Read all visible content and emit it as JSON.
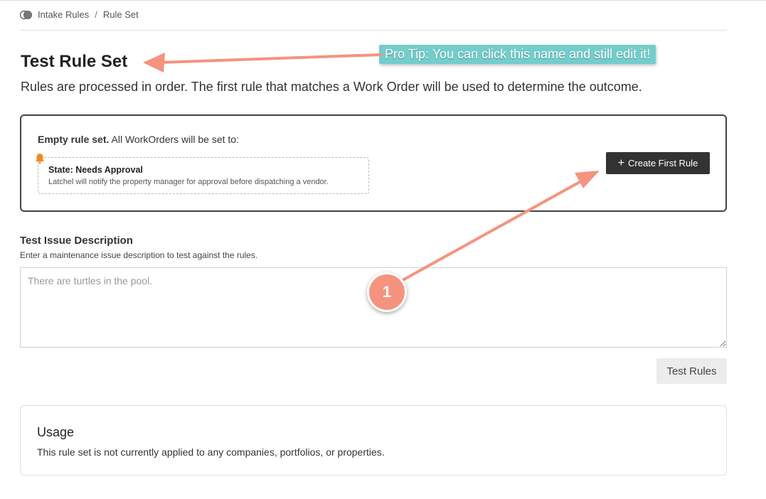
{
  "breadcrumb": {
    "icon": "toggle-circles-icon",
    "items": [
      "Intake Rules",
      "Rule Set"
    ],
    "separator": "/"
  },
  "page": {
    "title": "Test Rule Set",
    "subtitle": "Rules are processed in order. The first rule that matches a Work Order will be used to determine the outcome."
  },
  "annotation": {
    "pro_tip": "Pro Tip: You can click this name and still edit it!",
    "step_number": "1",
    "color": "#f5937f",
    "tip_color": "#72cdcb"
  },
  "rule_set": {
    "empty_bold": "Empty rule set.",
    "empty_rest": " All WorkOrders will be set to:",
    "state_icon": "bell-icon",
    "state_title": "State: Needs Approval",
    "state_description": "Latchel will notify the property manager for approval before dispatching a vendor.",
    "create_button": "Create First Rule",
    "create_icon": "plus-icon"
  },
  "test_issue": {
    "label": "Test Issue Description",
    "help": "Enter a maintenance issue description to test against the rules.",
    "placeholder": "There are turtles in the pool.",
    "value": "",
    "button": "Test Rules"
  },
  "usage": {
    "title": "Usage",
    "text": "This rule set is not currently applied to any companies, portfolios, or properties."
  }
}
